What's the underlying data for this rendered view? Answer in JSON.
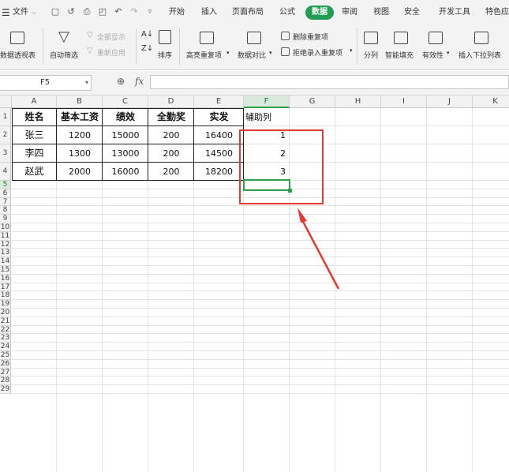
{
  "menu": {
    "file": "文件",
    "tabs": [
      "开始",
      "插入",
      "页面布局",
      "公式",
      "数据",
      "审阅",
      "视图",
      "安全",
      "开发工具",
      "特色应"
    ],
    "active_tab": "数据"
  },
  "ribbon": {
    "pivot": "数据透视表",
    "autofilter": "自动筛选",
    "show_all": "全部显示",
    "reapply": "重新应用",
    "sort": "排序",
    "highlight_dup": "高亮重复项",
    "data_compare": "数据对比",
    "delete_dup": "删除重复项",
    "reject_dup": "拒绝录入重复项",
    "split": "分列",
    "smart_fill": "智能填充",
    "validity": "有效性",
    "dropdown": "插入下拉列表"
  },
  "formula_bar": {
    "name_box": "F5",
    "fx": "fx",
    "formula": ""
  },
  "columns": [
    "A",
    "B",
    "C",
    "D",
    "E",
    "F",
    "G",
    "H",
    "I",
    "J",
    "K"
  ],
  "rows": [
    "1",
    "2",
    "3",
    "4",
    "5",
    "6",
    "7",
    "8",
    "9",
    "10",
    "11",
    "12",
    "13",
    "14",
    "15",
    "16",
    "17",
    "18",
    "19",
    "20",
    "21",
    "22",
    "23",
    "24",
    "25",
    "26",
    "27",
    "28",
    "29"
  ],
  "selected_cell": "F5",
  "table": {
    "headers": [
      "姓名",
      "基本工资",
      "绩效",
      "全勤奖",
      "实发",
      "辅助列"
    ],
    "rows": [
      [
        "张三",
        "1200",
        "15000",
        "200",
        "16400",
        "1"
      ],
      [
        "李四",
        "1300",
        "13000",
        "200",
        "14500",
        "2"
      ],
      [
        "赵武",
        "2000",
        "16000",
        "200",
        "18200",
        "3"
      ]
    ]
  },
  "colors": {
    "accent": "#1f9d55",
    "highlight": "#e53935",
    "selection": "#2e9f4a"
  }
}
